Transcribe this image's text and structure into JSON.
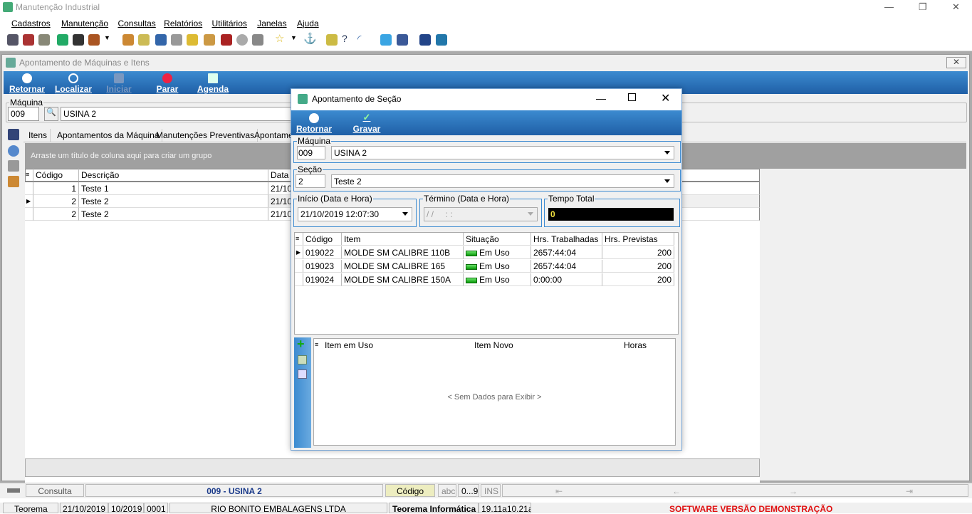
{
  "app": {
    "title": "Manutenção Industrial"
  },
  "menu": [
    "Cadastros",
    "Manutenção",
    "Consultas",
    "Relatórios",
    "Utilitários",
    "Janelas",
    "Ajuda"
  ],
  "child": {
    "title": "Apontamento de Máquinas e Itens",
    "toolbar": {
      "retornar": "Retornar",
      "localizar": "Localizar",
      "iniciar": "Iniciar",
      "parar": "Parar",
      "agenda": "Agenda"
    },
    "maquina_label": "Máquina",
    "maquina_code": "009",
    "maquina_name": "USINA 2",
    "tabs": [
      "Itens",
      "Apontamentos da Máquina",
      "Manutenções Preventivas",
      "Apontamer"
    ],
    "group_hint": "Arraste um título de coluna aqui para criar um grupo",
    "grid_headers": [
      "Código",
      "Descrição",
      "Data I"
    ],
    "rows": [
      {
        "codigo": "1",
        "descricao": "Teste 1",
        "data": "21/10"
      },
      {
        "codigo": "2",
        "descricao": "Teste 2",
        "data": "21/10"
      },
      {
        "codigo": "2",
        "descricao": "Teste 2",
        "data": "21/10"
      }
    ]
  },
  "dialog": {
    "title": "Apontamento de Seção",
    "retornar": "Retornar",
    "gravar": "Gravar",
    "maquina_label": "Máquina",
    "maquina_code": "009",
    "maquina_name": "USINA 2",
    "secao_label": "Seção",
    "secao_code": "2",
    "secao_name": "Teste 2",
    "inicio_label": "Início (Data e Hora)",
    "inicio_value": "21/10/2019 12:07:30",
    "termino_label": "Término (Data e Hora)",
    "termino_value": "/ /     : :",
    "tempo_label": "Tempo Total",
    "tempo_value": "0",
    "items_headers": [
      "Código",
      "Item",
      "Situação",
      "Hrs. Trabalhadas",
      "Hrs. Previstas"
    ],
    "items": [
      {
        "codigo": "019022",
        "item": "MOLDE SM CALIBRE 110B",
        "situacao": "Em Uso",
        "trab": "2657:44:04",
        "prev": "200"
      },
      {
        "codigo": "019023",
        "item": "MOLDE SM CALIBRE 165",
        "situacao": "Em Uso",
        "trab": "2657:44:04",
        "prev": "200"
      },
      {
        "codigo": "019024",
        "item": "MOLDE SM CALIBRE 150A",
        "situacao": "Em Uso",
        "trab": "0:00:00",
        "prev": "200"
      }
    ],
    "sub_headers": [
      "Item em Uso",
      "Item Novo",
      "Horas"
    ],
    "sub_empty": "< Sem Dados para Exibir >"
  },
  "status": {
    "mode": "Consulta",
    "machine": "009 - USINA 2",
    "field": "Código",
    "abc": "abc",
    "num": "0...9",
    "ins": "INS",
    "company_short": "Teorema",
    "date": "21/10/2019",
    "period": "10/2019",
    "code": "0001",
    "company": "RIO BONITO EMBALAGENS LTDA",
    "vendor": "Teorema Informática",
    "version": "19.11a10.21a",
    "demo": "SOFTWARE VERSÃO DEMONSTRAÇÃO"
  }
}
